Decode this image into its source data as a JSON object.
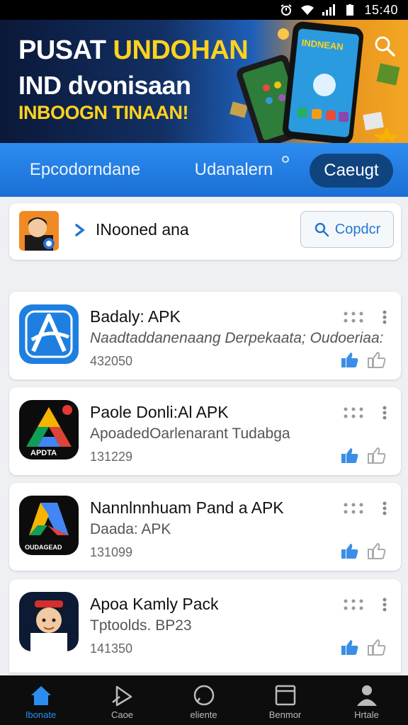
{
  "status_bar": {
    "time": "15:40"
  },
  "banner": {
    "line1_white": "PUSAT",
    "line1_yellow": "UNDOHAN",
    "line2": "IND dvonisaan",
    "line3": "INBOOGN TINAAN!"
  },
  "tabs": [
    {
      "label": "Epcodorndane",
      "active": false
    },
    {
      "label": "Udanalern",
      "active": false
    },
    {
      "label": "Caeugt",
      "active": true
    }
  ],
  "user_card": {
    "name": "INooned ana",
    "search_button": "Copdcr"
  },
  "apps": [
    {
      "title": "Badaly: APK",
      "subtitle": "Naadtaddanenaang Derpekaata; Oudoeriaa:",
      "count": "432050",
      "icon": "blue-a-icon"
    },
    {
      "title": "Paole Donli:Al APK",
      "subtitle": "ApoadedOarlenarant Tudabga",
      "count": "131229",
      "icon": "drive-style-icon"
    },
    {
      "title": "Nannlnnhuam Pand a APK",
      "subtitle": "Daada: APK",
      "count": "131099",
      "icon": "colorful-a-icon",
      "icon_text": "OUDAGEAD"
    },
    {
      "title": "Apoa Kamly Pack",
      "subtitle": "Tptoolds. BP23",
      "count": "141350",
      "icon": "character-avatar-icon"
    }
  ],
  "bottom_nav": [
    {
      "label": "Ibonate",
      "icon": "home-icon",
      "active": true
    },
    {
      "label": "Caoe",
      "icon": "play-icon",
      "active": false
    },
    {
      "label": "eliente",
      "icon": "circle-icon",
      "active": false
    },
    {
      "label": "Benmor",
      "icon": "window-icon",
      "active": false
    },
    {
      "label": "Hrtale",
      "icon": "person-icon",
      "active": false
    }
  ],
  "colors": {
    "primary_blue": "#2d8cf0",
    "tab_active": "#10447f",
    "banner_yellow": "#ffd21e",
    "like_blue": "#3a8ee6"
  }
}
